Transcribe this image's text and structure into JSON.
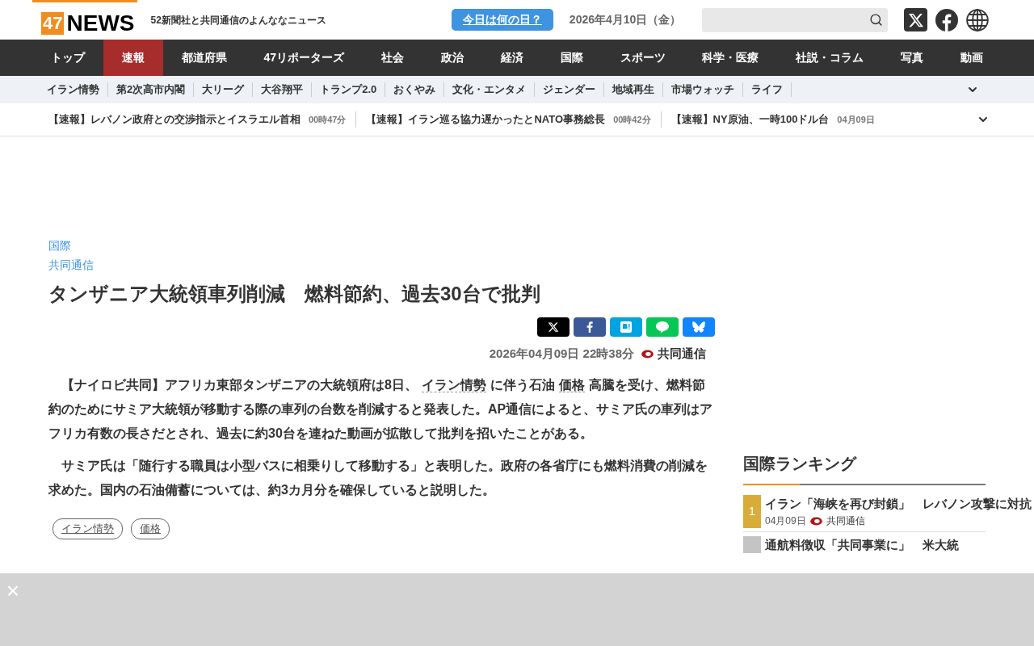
{
  "header": {
    "logo_number": "47",
    "logo_word": "NEWS",
    "tagline": "52新聞社と共同通信のよんななニュース",
    "today_button": "今日は何の日？",
    "date": "2026年4月10日（金）"
  },
  "nav": [
    {
      "label": "トップ",
      "selected": false
    },
    {
      "label": "速報",
      "selected": true
    },
    {
      "label": "都道府県",
      "selected": false
    },
    {
      "label": "47リポーターズ",
      "selected": false
    },
    {
      "label": "社会",
      "selected": false
    },
    {
      "label": "政治",
      "selected": false
    },
    {
      "label": "経済",
      "selected": false
    },
    {
      "label": "国際",
      "selected": false
    },
    {
      "label": "スポーツ",
      "selected": false
    },
    {
      "label": "科学・医療",
      "selected": false
    },
    {
      "label": "社説・コラム",
      "selected": false
    },
    {
      "label": "写真",
      "selected": false
    },
    {
      "label": "動画",
      "selected": false
    }
  ],
  "topics": [
    "イラン情勢",
    "第2次高市内閣",
    "大リーグ",
    "大谷翔平",
    "トランプ2.0",
    "おくやみ",
    "文化・エンタメ",
    "ジェンダー",
    "地域再生",
    "市場ウォッチ",
    "ライフ"
  ],
  "ticker": [
    {
      "headline": "【速報】レバノン政府との交渉指示とイスラエル首相",
      "time": "00時47分"
    },
    {
      "headline": "【速報】イラン巡る協力遅かったとNATO事務総長",
      "time": "00時42分"
    },
    {
      "headline": "【速報】NY原油、一時100ドル台",
      "time": "04月09日"
    }
  ],
  "article": {
    "category": "国際",
    "source_link": "共同通信",
    "title": "タンザニア大統領車列削減　燃料節約、過去30台で批判",
    "datetime": "2026年04月09日 22時38分",
    "source": "共同通信",
    "paragraphs": [
      [
        {
          "kind": "text",
          "text": "【ナイロビ共同】アフリカ東部タンザニアの大統領府は8日、"
        },
        {
          "kind": "link",
          "text": "イラン情勢"
        },
        {
          "kind": "text",
          "text": "に伴う石油"
        },
        {
          "kind": "link",
          "text": "価格"
        },
        {
          "kind": "text",
          "text": "高騰を受け、燃料節約のためにサミア大統領が移動する際の車列の台数を削減すると発表した。AP通信によると、サミア氏の車列はアフリカ有数の長さだとされ、過去に約30台を連ねた動画が拡散して批判を招いたことがある。"
        }
      ],
      [
        {
          "kind": "text",
          "text": "サミア氏は「随行する職員は小型バスに相乗りして移動する」と表明した。政府の各省庁にも燃料消費の削減を求めた。国内の石油備蓄については、約3カ月分を確保していると説明した。"
        }
      ]
    ],
    "tags": [
      "イラン情勢",
      "価格"
    ]
  },
  "ranking": {
    "title": "国際ランキング",
    "items": [
      {
        "rank": "1",
        "color": "#d9ac3a",
        "title": "イラン「海峡を再び封鎖」　レバノン攻撃に対抗",
        "date": "04月09日",
        "source": "共同通信"
      },
      {
        "color": "#c4c4c4",
        "title": "通航料徴収「共同事業に」　米大統"
      }
    ]
  },
  "overlay": {
    "close": "×"
  }
}
